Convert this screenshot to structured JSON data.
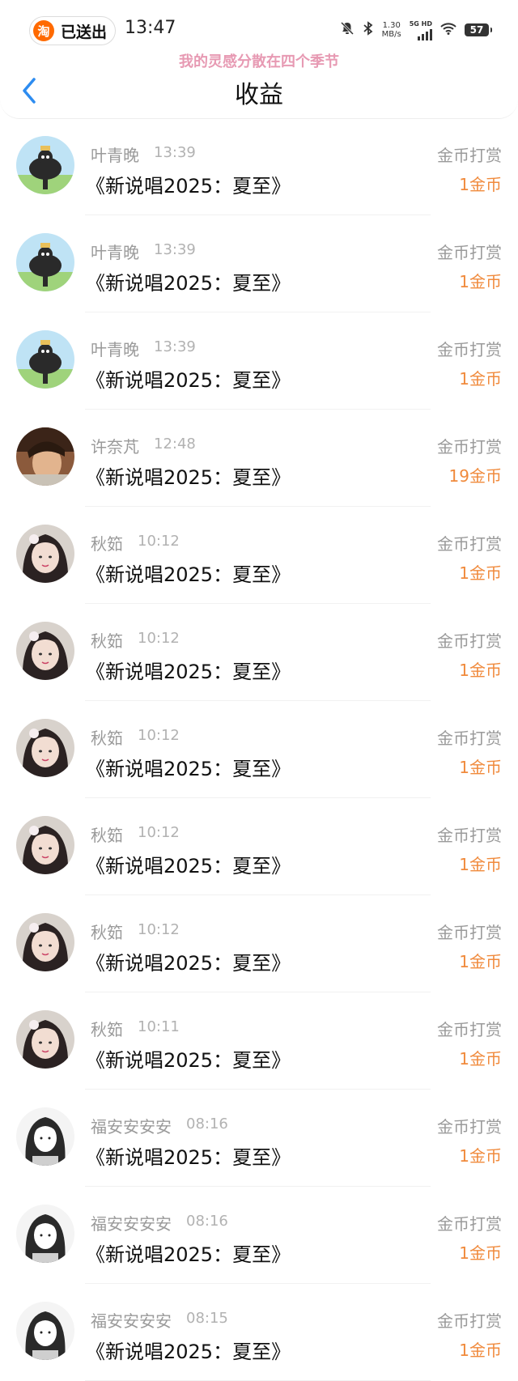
{
  "status_bar": {
    "pill_icon": "淘",
    "pill_label": "已送出",
    "time": "13:47",
    "net_speed_value": "1.30",
    "net_speed_unit": "MB/s",
    "net_tag": "5G HD",
    "battery": "57",
    "icons": [
      "bell-off-icon",
      "bluetooth-icon",
      "signal-icon",
      "wifi-icon",
      "battery-icon"
    ]
  },
  "marquee_text": "我的灵感分散在四个季节",
  "header": {
    "title": "收益",
    "back_icon": "chevron-left-icon"
  },
  "colors": {
    "accent": "#f08a3c",
    "back": "#2d8cf0",
    "muted": "#9a9a9a",
    "marquee": "#e79ab3"
  },
  "records": [
    {
      "name": "叶青晚",
      "time": "13:39",
      "title": "《新说唱2025：夏至》",
      "type": "金币打赏",
      "amount": "1金币",
      "avatar": "cartoon"
    },
    {
      "name": "叶青晚",
      "time": "13:39",
      "title": "《新说唱2025：夏至》",
      "type": "金币打赏",
      "amount": "1金币",
      "avatar": "cartoon"
    },
    {
      "name": "叶青晚",
      "time": "13:39",
      "title": "《新说唱2025：夏至》",
      "type": "金币打赏",
      "amount": "1金币",
      "avatar": "cartoon"
    },
    {
      "name": "许奈芃",
      "time": "12:48",
      "title": "《新说唱2025：夏至》",
      "type": "金币打赏",
      "amount": "19金币",
      "avatar": "photo-boy"
    },
    {
      "name": "秋筎",
      "time": "10:12",
      "title": "《新说唱2025：夏至》",
      "type": "金币打赏",
      "amount": "1金币",
      "avatar": "photo-girl"
    },
    {
      "name": "秋筎",
      "time": "10:12",
      "title": "《新说唱2025：夏至》",
      "type": "金币打赏",
      "amount": "1金币",
      "avatar": "photo-girl"
    },
    {
      "name": "秋筎",
      "time": "10:12",
      "title": "《新说唱2025：夏至》",
      "type": "金币打赏",
      "amount": "1金币",
      "avatar": "photo-girl"
    },
    {
      "name": "秋筎",
      "time": "10:12",
      "title": "《新说唱2025：夏至》",
      "type": "金币打赏",
      "amount": "1金币",
      "avatar": "photo-girl"
    },
    {
      "name": "秋筎",
      "time": "10:12",
      "title": "《新说唱2025：夏至》",
      "type": "金币打赏",
      "amount": "1金币",
      "avatar": "photo-girl"
    },
    {
      "name": "秋筎",
      "time": "10:11",
      "title": "《新说唱2025：夏至》",
      "type": "金币打赏",
      "amount": "1金币",
      "avatar": "photo-girl"
    },
    {
      "name": "福安安安安",
      "time": "08:16",
      "title": "《新说唱2025：夏至》",
      "type": "金币打赏",
      "amount": "1金币",
      "avatar": "anime-bw"
    },
    {
      "name": "福安安安安",
      "time": "08:16",
      "title": "《新说唱2025：夏至》",
      "type": "金币打赏",
      "amount": "1金币",
      "avatar": "anime-bw"
    },
    {
      "name": "福安安安安",
      "time": "08:15",
      "title": "《新说唱2025：夏至》",
      "type": "金币打赏",
      "amount": "1金币",
      "avatar": "anime-bw"
    }
  ]
}
